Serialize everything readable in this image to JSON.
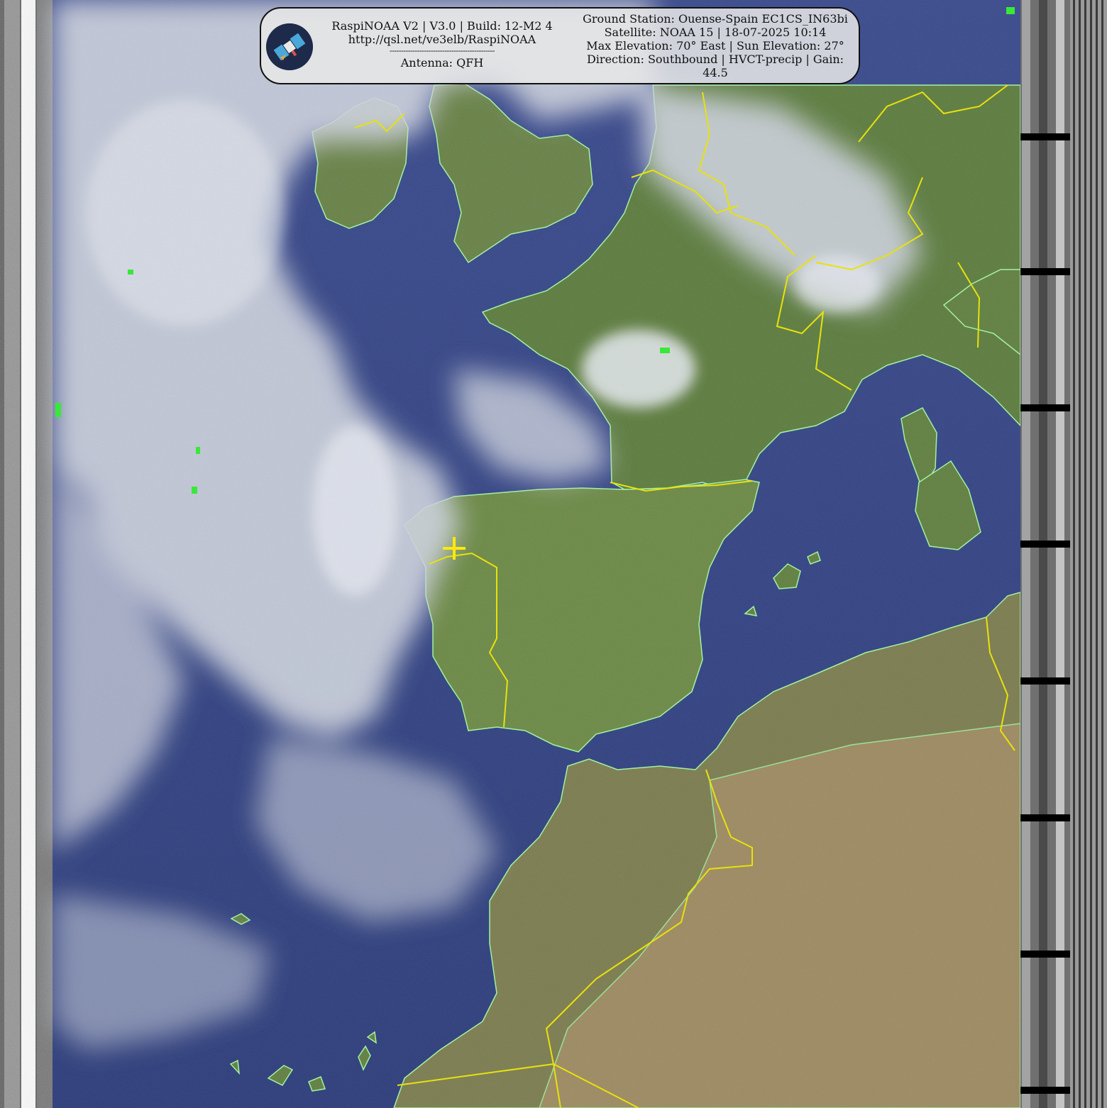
{
  "header": {
    "title_line": "RaspiNOAA V2 | V3.0 | Build: 12-M2 4",
    "url": "http://qsl.net/ve3elb/RaspiNOAA",
    "separator": "----------------------------------------------",
    "antenna": "Antenna: QFH",
    "ground_station": "Ground Station: Ouense-Spain EC1CS_IN63bi",
    "satellite": "Satellite: NOAA 15 | 18-07-2025 10:14",
    "elevation": "Max Elevation: 70° East | Sun Elevation: 27°",
    "direction": "Direction: Southbound | HVCT-precip | Gain: 44.5"
  },
  "colors": {
    "ocean": "#2e3f7e",
    "land": "#5d7a40",
    "desert": "#9b8660",
    "cloud": "#c7ccd6",
    "coastline": "#9ef29e",
    "border": "#e6e000",
    "marker": "#ffe800"
  },
  "icons": {
    "logo": "satellite-icon",
    "marker": "ground-station-cross-icon"
  }
}
